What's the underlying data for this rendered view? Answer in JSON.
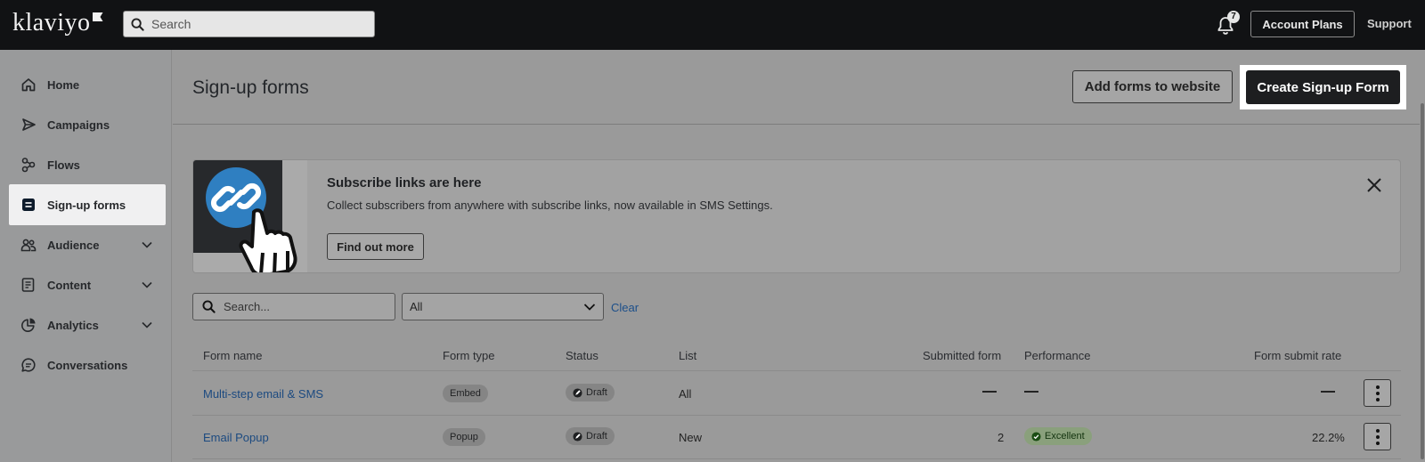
{
  "topbar": {
    "logo_text": "klaviyo",
    "search_placeholder": "Search",
    "notification_count": "7",
    "account_plans_label": "Account Plans",
    "support_label": "Support"
  },
  "sidebar": {
    "items": [
      {
        "label": "Home",
        "icon": "home-icon"
      },
      {
        "label": "Campaigns",
        "icon": "send-icon"
      },
      {
        "label": "Flows",
        "icon": "flows-icon"
      },
      {
        "label": "Sign-up forms",
        "icon": "form-icon",
        "active": true
      },
      {
        "label": "Audience",
        "icon": "people-icon",
        "expandable": true
      },
      {
        "label": "Content",
        "icon": "content-icon",
        "expandable": true
      },
      {
        "label": "Analytics",
        "icon": "pie-chart-icon",
        "expandable": true
      },
      {
        "label": "Conversations",
        "icon": "chat-icon"
      }
    ]
  },
  "header": {
    "title": "Sign-up forms",
    "add_forms_label": "Add forms to website",
    "create_label": "Create Sign-up Form"
  },
  "banner": {
    "title": "Subscribe links are here",
    "text": "Collect subscribers from anywhere with subscribe links, now available in SMS Settings.",
    "button_label": "Find out more",
    "accent_color": "#2f7fc1"
  },
  "filters": {
    "search_placeholder": "Search...",
    "select_value": "All",
    "clear_label": "Clear"
  },
  "table": {
    "columns": [
      "Form name",
      "Form type",
      "Status",
      "List",
      "Submitted form",
      "Performance",
      "Form submit rate"
    ],
    "rows": [
      {
        "name": "Multi-step email & SMS",
        "type": "Embed",
        "status": "Draft",
        "list": "All",
        "submitted": "",
        "performance": "",
        "rate": ""
      },
      {
        "name": "Email Popup",
        "type": "Popup",
        "status": "Draft",
        "list": "New",
        "submitted": "2",
        "performance": "Excellent",
        "rate": "22.2%"
      }
    ]
  }
}
